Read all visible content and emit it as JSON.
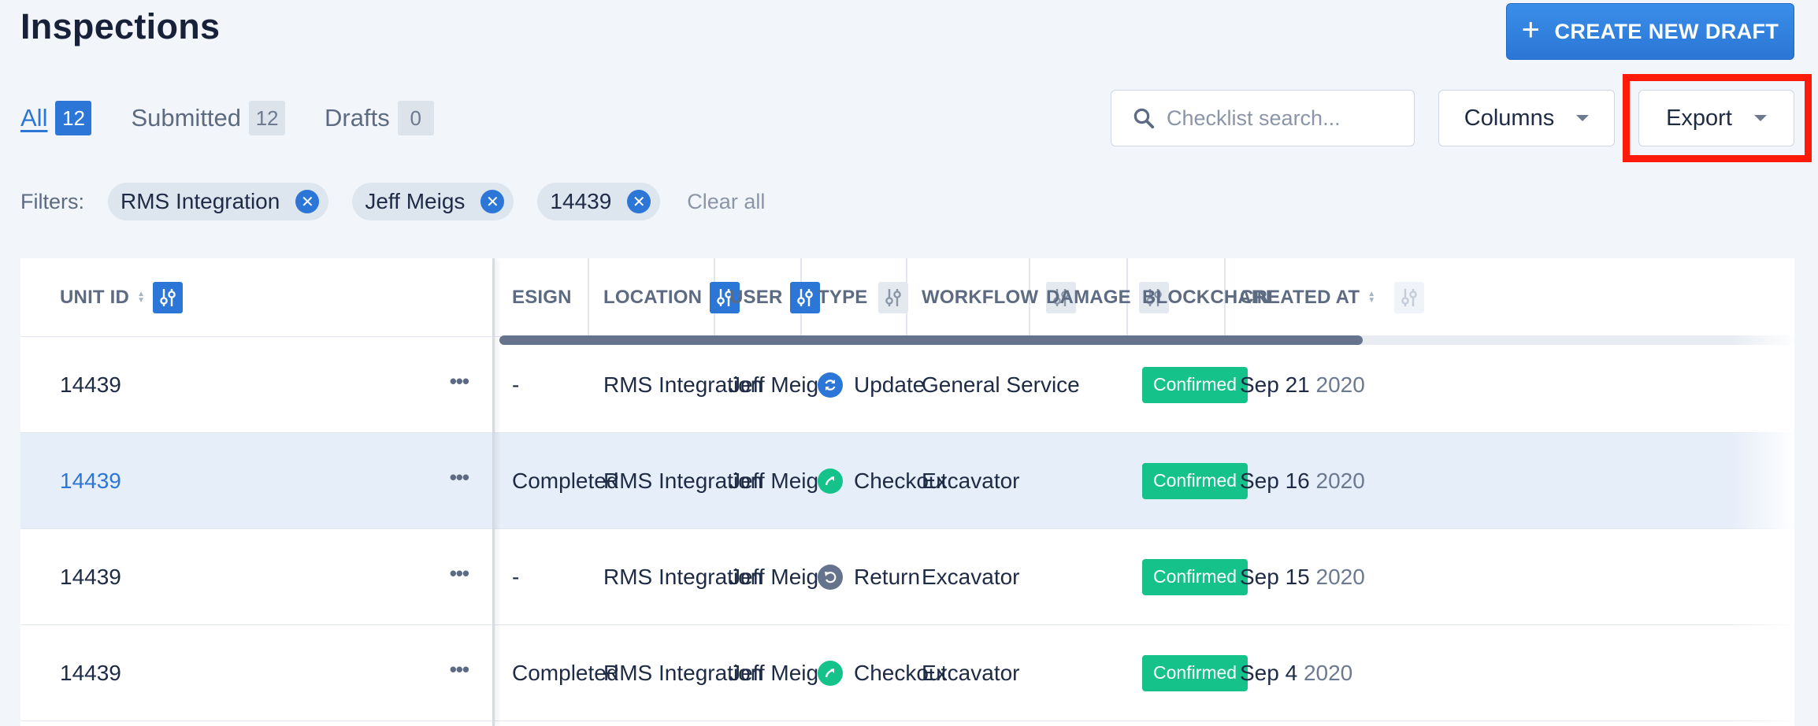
{
  "page": {
    "title": "Inspections",
    "create_label": "CREATE NEW DRAFT"
  },
  "tabs": [
    {
      "label": "All",
      "count": "12"
    },
    {
      "label": "Submitted",
      "count": "12"
    },
    {
      "label": "Drafts",
      "count": "0"
    }
  ],
  "search": {
    "placeholder": "Checklist search..."
  },
  "columns_label": "Columns",
  "export_label": "Export",
  "filters": {
    "label": "Filters:",
    "chips": [
      "RMS Integration",
      "Jeff Meigs",
      "14439"
    ],
    "clear_label": "Clear all"
  },
  "table": {
    "headers": {
      "unit_id": "UNIT ID",
      "esign": "ESIGN",
      "location": "LOCATION",
      "user": "USER",
      "type": "TYPE",
      "workflow": "WORKFLOW",
      "damage": "DAMAGE",
      "blockchain": "BLOCKCHAIN",
      "created_at": "CREATED AT"
    },
    "rows": [
      {
        "unit_id": "14439",
        "esign": "-",
        "location": "RMS Integration",
        "user": "Jeff Meigs",
        "type": "Update",
        "type_icon": "refresh-icon",
        "type_color": "#2b76d6",
        "workflow": "General Service",
        "damage": "",
        "blockchain": "Confirmed",
        "date": "Sep 21",
        "year": "2020"
      },
      {
        "unit_id": "14439",
        "esign": "Completed",
        "location": "RMS Integration",
        "user": "Jeff Meigs",
        "type": "Checkout",
        "type_icon": "arrow-up-right-icon",
        "type_color": "#14c28a",
        "workflow": "Excavator",
        "damage": "",
        "blockchain": "Confirmed",
        "date": "Sep 16",
        "year": "2020"
      },
      {
        "unit_id": "14439",
        "esign": "-",
        "location": "RMS Integration",
        "user": "Jeff Meigs",
        "type": "Return",
        "type_icon": "return-icon",
        "type_color": "#65748c",
        "workflow": "Excavator",
        "damage": "",
        "blockchain": "Confirmed",
        "date": "Sep 15",
        "year": "2020"
      },
      {
        "unit_id": "14439",
        "esign": "Completed",
        "location": "RMS Integration",
        "user": "Jeff Meigs",
        "type": "Checkout",
        "type_icon": "arrow-up-right-icon",
        "type_color": "#14c28a",
        "workflow": "Excavator",
        "damage": "",
        "blockchain": "Confirmed",
        "date": "Sep 4",
        "year": "2020"
      }
    ]
  }
}
